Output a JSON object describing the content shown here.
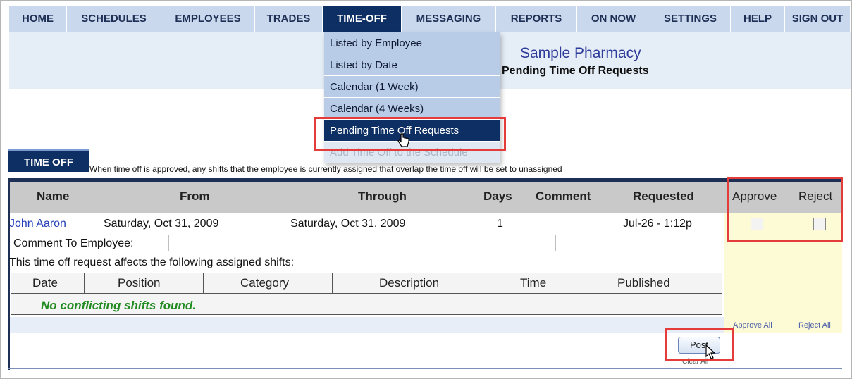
{
  "nav": {
    "items": [
      {
        "label": "HOME",
        "width": 82
      },
      {
        "label": "SCHEDULES",
        "width": 134
      },
      {
        "label": "EMPLOYEES",
        "width": 133
      },
      {
        "label": "TRADES",
        "width": 96
      },
      {
        "label": "TIME-OFF",
        "width": 112
      },
      {
        "label": "MESSAGING",
        "width": 134
      },
      {
        "label": "REPORTS",
        "width": 115
      },
      {
        "label": "ON NOW",
        "width": 104
      },
      {
        "label": "SETTINGS",
        "width": 114
      },
      {
        "label": "HELP",
        "width": 77
      },
      {
        "label": "SIGN OUT",
        "width": 93
      }
    ]
  },
  "header": {
    "org_name": "Sample Pharmacy",
    "page_title": "Pending Time Off Requests"
  },
  "dropdown": {
    "items": [
      {
        "label": "Listed by Employee"
      },
      {
        "label": "Listed by Date"
      },
      {
        "label": "Calendar (1 Week)"
      },
      {
        "label": "Calendar (4 Weeks)"
      },
      {
        "label": "Pending Time Off Requests"
      },
      {
        "label": "Add Time Off to the Schedule"
      }
    ]
  },
  "tab_label": "TIME OFF",
  "note": "When time off is approved, any shifts that the employee is currently assigned that overlap the time off will be set to unassigned",
  "table": {
    "headers": {
      "name": "Name",
      "from": "From",
      "through": "Through",
      "days": "Days",
      "comment": "Comment",
      "requested": "Requested",
      "approve": "Approve",
      "reject": "Reject"
    },
    "row": {
      "name": "John Aaron",
      "from": "Saturday, Oct 31, 2009",
      "through": "Saturday, Oct 31, 2009",
      "days": "1",
      "requested": "Jul-26 - 1:12p"
    },
    "comment_label": "Comment To Employee:",
    "comment_value": "",
    "affects_label": "This time off request affects the following assigned shifts:",
    "shift_headers": {
      "date": "Date",
      "position": "Position",
      "category": "Category",
      "description": "Description",
      "time": "Time",
      "published": "Published"
    },
    "no_conflict": "No conflicting shifts found.",
    "approve_all": "Approve All",
    "reject_all": "Reject All",
    "post_label": "Post",
    "clear_label": "Clear All"
  },
  "colors": {
    "nav_bg": "#c9d8ec",
    "nav_active": "#0e2f63",
    "highlight": "#e43b3b",
    "success": "#228b22"
  }
}
